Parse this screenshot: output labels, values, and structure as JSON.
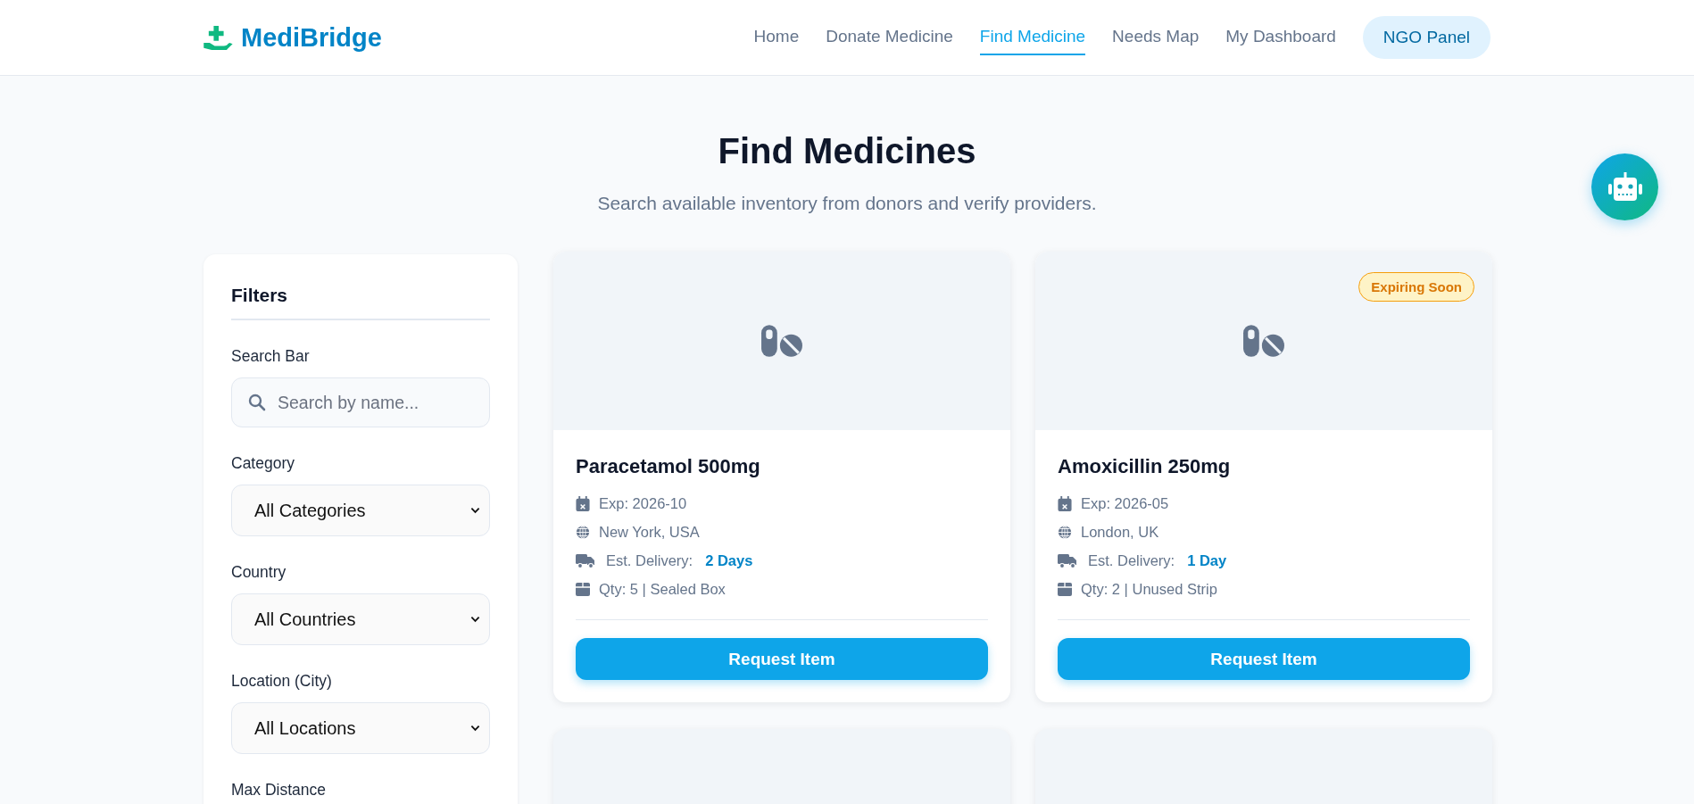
{
  "header": {
    "logo": "MediBridge",
    "nav": [
      {
        "label": "Home",
        "selected": false
      },
      {
        "label": "Donate Medicine",
        "selected": false
      },
      {
        "label": "Find Medicine",
        "selected": true
      },
      {
        "label": "Needs Map",
        "selected": false
      },
      {
        "label": "My Dashboard",
        "selected": false
      }
    ],
    "panel_button": "NGO Panel"
  },
  "page": {
    "title": "Find Medicines",
    "subtitle": "Search available inventory from donors and verify providers."
  },
  "filters": {
    "title": "Filters",
    "fields": [
      {
        "kind": "search",
        "label": "Search Bar",
        "placeholder": "Search by name..."
      },
      {
        "kind": "select",
        "label": "Category",
        "value": "All Categories"
      },
      {
        "kind": "select",
        "label": "Country",
        "value": "All Countries"
      },
      {
        "kind": "select",
        "label": "Location (City)",
        "value": "All Locations"
      },
      {
        "kind": "label",
        "label": "Max Distance"
      }
    ]
  },
  "listings": [
    {
      "kind": "medicine",
      "name": "Paracetamol 500mg",
      "expiry": "Exp: 2026-10",
      "location": "New York, USA",
      "delivery_label": "Est. Delivery:",
      "delivery": "2 Days",
      "quantity": "Qty: 5 | Sealed Box",
      "button": "Request Item"
    },
    {
      "kind": "medicine",
      "badge": "Expiring Soon",
      "name": "Amoxicillin 250mg",
      "expiry": "Exp: 2026-05",
      "location": "London, UK",
      "delivery_label": "Est. Delivery:",
      "delivery": "1 Day",
      "quantity": "Qty: 2 | Unused Strip",
      "button": "Request Item"
    },
    {
      "kind": "placeholder"
    },
    {
      "kind": "placeholder"
    }
  ]
}
